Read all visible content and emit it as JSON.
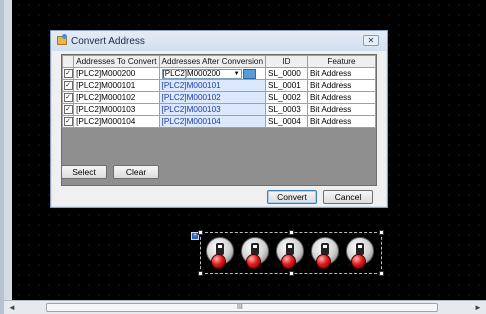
{
  "dialog": {
    "title": "Convert Address",
    "close_label": "✕",
    "table": {
      "headers": [
        "",
        "Addresses To Convert",
        "Addresses After Conversion",
        "ID",
        "Feature"
      ],
      "rows": [
        {
          "checked": true,
          "from": "[PLC2]M000200",
          "to": "[PLC2]M000200",
          "id": "SL_0000",
          "feature": "Bit Address"
        },
        {
          "checked": true,
          "from": "[PLC2]M000101",
          "to": "[PLC2]M000101",
          "id": "SL_0001",
          "feature": "Bit Address"
        },
        {
          "checked": true,
          "from": "[PLC2]M000102",
          "to": "[PLC2]M000102",
          "id": "SL_0002",
          "feature": "Bit Address"
        },
        {
          "checked": true,
          "from": "[PLC2]M000103",
          "to": "[PLC2]M000103",
          "id": "SL_0003",
          "feature": "Bit Address"
        },
        {
          "checked": true,
          "from": "[PLC2]M000104",
          "to": "[PLC2]M000104",
          "id": "SL_0004",
          "feature": "Bit Address"
        }
      ]
    },
    "buttons": {
      "select": "Select",
      "clear": "Clear",
      "convert": "Convert",
      "cancel": "Cancel"
    }
  },
  "scrollbar": {
    "left_arrow": "◄",
    "right_arrow": "►",
    "grip": "III"
  },
  "colors": {
    "canvas": "#000000",
    "selected_cell_text": "#1f3ca8",
    "lamp": "#e21d1d"
  },
  "icons": [
    "convert-address-icon",
    "close-icon",
    "dropdown-arrow-icon",
    "address-browse-icon",
    "toggle-switch-icon"
  ]
}
